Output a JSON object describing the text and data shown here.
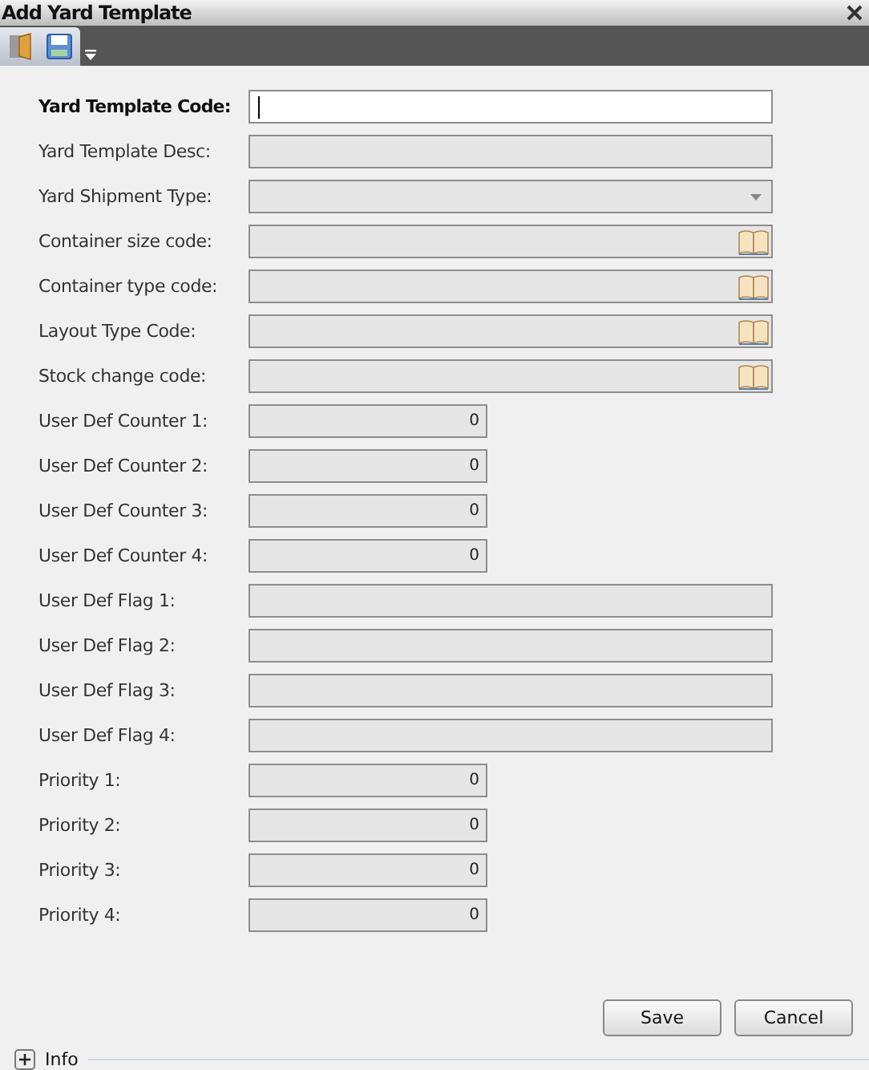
{
  "window": {
    "title": "Add Yard Template"
  },
  "fields": [
    {
      "label": "Yard Template Code:",
      "kind": "text",
      "required": true,
      "disabled": false
    },
    {
      "label": "Yard Template Desc:",
      "kind": "text",
      "required": false,
      "disabled": true
    },
    {
      "label": "Yard Shipment Type:",
      "kind": "select",
      "required": false,
      "disabled": true
    },
    {
      "label": "Container size code:",
      "kind": "lookup",
      "required": false,
      "disabled": true
    },
    {
      "label": "Container type code:",
      "kind": "lookup",
      "required": false,
      "disabled": true
    },
    {
      "label": "Layout Type Code:",
      "kind": "lookup",
      "required": false,
      "disabled": true
    },
    {
      "label": "Stock change code:",
      "kind": "lookup",
      "required": false,
      "disabled": true
    },
    {
      "label": "User Def Counter 1:",
      "kind": "number",
      "value": "0",
      "required": false,
      "disabled": true
    },
    {
      "label": "User Def Counter 2:",
      "kind": "number",
      "value": "0",
      "required": false,
      "disabled": true
    },
    {
      "label": "User Def Counter 3:",
      "kind": "number",
      "value": "0",
      "required": false,
      "disabled": true
    },
    {
      "label": "User Def Counter 4:",
      "kind": "number",
      "value": "0",
      "required": false,
      "disabled": true
    },
    {
      "label": "User Def Flag 1:",
      "kind": "text",
      "required": false,
      "disabled": true
    },
    {
      "label": "User Def Flag 2:",
      "kind": "text",
      "required": false,
      "disabled": true
    },
    {
      "label": "User Def Flag 3:",
      "kind": "text",
      "required": false,
      "disabled": true
    },
    {
      "label": "User Def Flag 4:",
      "kind": "text",
      "required": false,
      "disabled": true
    },
    {
      "label": "Priority 1:",
      "kind": "number",
      "value": "0",
      "required": false,
      "disabled": true
    },
    {
      "label": "Priority 2:",
      "kind": "number",
      "value": "0",
      "required": false,
      "disabled": true
    },
    {
      "label": "Priority 3:",
      "kind": "number",
      "value": "0",
      "required": false,
      "disabled": true
    },
    {
      "label": "Priority 4:",
      "kind": "number",
      "value": "0",
      "required": false,
      "disabled": true
    }
  ],
  "buttons": [
    "Save",
    "Cancel"
  ],
  "info": {
    "label": "Info",
    "expanded": false
  }
}
